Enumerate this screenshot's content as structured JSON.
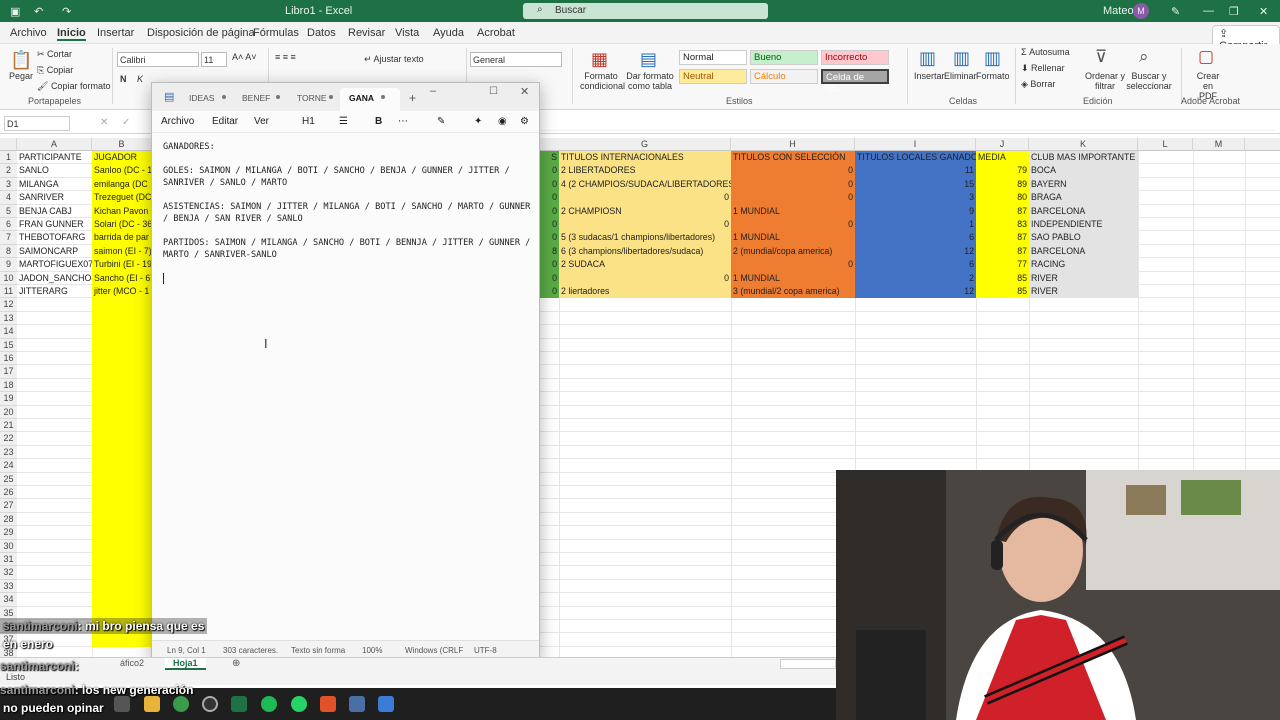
{
  "excel": {
    "window_title": "Libro1 - Excel",
    "search_placeholder": "Buscar",
    "user_name": "Mateo",
    "user_initial": "M",
    "menu": [
      "Archivo",
      "Inicio",
      "Insertar",
      "Disposición de página",
      "Fórmulas",
      "Datos",
      "Revisar",
      "Vista",
      "Ayuda",
      "Acrobat"
    ],
    "share_label": "Compartir",
    "ribbon": {
      "paste": "Pegar",
      "cut": "Cortar",
      "copy": "Copiar",
      "copy_format": "Copiar formato",
      "clipboard_group": "Portapapeles",
      "font_name": "Calibri",
      "font_size": "11",
      "wrap_text": "Ajustar texto",
      "merge_center": "Combinar y centrar",
      "number_format": "General",
      "cond_format": "Formato condicional",
      "table_format": "Dar formato como tabla",
      "styles_group": "Estilos",
      "style_normal": "Normal",
      "style_bueno": "Bueno",
      "style_incorrecto": "Incorrecto",
      "style_neutral": "Neutral",
      "style_calculo": "Cálculo",
      "style_celda": "Celda de co...",
      "insert": "Insertar",
      "delete": "Eliminar",
      "format": "Formato",
      "cells_group": "Celdas",
      "autosum": "Autosuma",
      "fill": "Rellenar",
      "clear": "Borrar",
      "sort_filter": "Ordenar y filtrar",
      "find_select": "Buscar y seleccionar",
      "edit_group": "Edición",
      "create_pdf": "Crear en PDF",
      "acrobat_group": "Adobe Acrobat"
    },
    "name_box": "D1",
    "columns": [
      "A",
      "B",
      "G",
      "H",
      "I",
      "J",
      "K",
      "L",
      "M"
    ],
    "row_numbers": [
      "1",
      "2",
      "3",
      "4",
      "5",
      "6",
      "7",
      "8",
      "9",
      "10",
      "11",
      "12",
      "13",
      "14",
      "15",
      "16",
      "17",
      "18",
      "19",
      "20",
      "21",
      "22",
      "23",
      "24",
      "25",
      "26",
      "27",
      "28",
      "29",
      "30",
      "31",
      "32",
      "33",
      "34",
      "35",
      "36",
      "37",
      "38"
    ],
    "headers": {
      "a": "PARTICIPANTE",
      "b": "JUGADOR",
      "f_tail": "S",
      "g": "TITULOS INTERNACIONALES",
      "h": "TITULOS CON SELECCIÓN",
      "i": "TITULOS LOCALES GANADOS",
      "j": "MEDIA",
      "k": "CLUB MAS IMPORTANTE"
    },
    "rows": [
      {
        "a": "SANLO",
        "b": "Sanloo (DC - 1",
        "f": "0",
        "g": "2 LIBERTADORES",
        "gnum": "",
        "h": "",
        "hnum": "0",
        "i": "11",
        "j": "79",
        "k": "BOCA"
      },
      {
        "a": "MILANGA",
        "b": "emilanga (DC",
        "f": "0",
        "g": "4 (2 CHAMPIOS/SUDACA/LIBERTADORES)",
        "gnum": "",
        "h": "",
        "hnum": "0",
        "i": "15",
        "j": "89",
        "k": "BAYERN"
      },
      {
        "a": "SANRIVER",
        "b": "Trezeguet (DC",
        "f": "0",
        "g": "",
        "gnum": "0",
        "h": "",
        "hnum": "0",
        "i": "3",
        "j": "80",
        "k": "BRAGA"
      },
      {
        "a": "BENJA CABJ",
        "b": "Kichan Pavon",
        "f": "0",
        "g": "2 CHAMPIOSN",
        "gnum": "",
        "h": "1 MUNDIAL",
        "hnum": "",
        "i": "9",
        "j": "87",
        "k": "BARCELONA"
      },
      {
        "a": "FRAN GUNNER",
        "b": "Solari (DC - 36",
        "f": "0",
        "g": "",
        "gnum": "0",
        "h": "",
        "hnum": "0",
        "i": "1",
        "j": "83",
        "k": "INDEPENDIENTE"
      },
      {
        "a": "THEBOTOFARG",
        "b": "barrida de par",
        "f": "0",
        "g": "5 (3 sudacas/1 champions/libertadores)",
        "gnum": "",
        "h": "1 MUNDIAL",
        "hnum": "",
        "i": "6",
        "j": "87",
        "k": "SAO PABLO"
      },
      {
        "a": "SAIMONCARP",
        "b": "saimon (EI - 7)",
        "f": "8",
        "g": "6 (3 champions/libertadores/sudaca)",
        "gnum": "",
        "h": "2 (mundial/copa america)",
        "hnum": "",
        "i": "12",
        "j": "87",
        "k": "BARCELONA"
      },
      {
        "a": "MARTOFIGUEX07",
        "b": "Turbini (EI - 19",
        "f": "0",
        "g": "2 SUDACA",
        "gnum": "",
        "h": "",
        "hnum": "0",
        "i": "6",
        "j": "77",
        "k": "RACING"
      },
      {
        "a": "JADON_SANCHO8",
        "b": "Sancho (EI - 67",
        "f": "0",
        "g": "",
        "gnum": "0",
        "h": "1 MUNDIAL",
        "hnum": "",
        "i": "2",
        "j": "85",
        "k": "RIVER"
      },
      {
        "a": "JITTERARG",
        "b": "jitter (MCO - 1",
        "f": "0",
        "g": "2 liertadores",
        "gnum": "",
        "h": "3 (mundial/2 copa america)",
        "hnum": "",
        "i": "12",
        "j": "85",
        "k": "RIVER"
      }
    ],
    "sheet_tab_partial": "áfico2",
    "sheet_tab_active": "Hoja1",
    "status_ready": "Listo"
  },
  "notepad": {
    "tabs": [
      "IDEAS",
      "BENEF",
      "TORNE",
      "GANA"
    ],
    "active_tab": "GANA",
    "new_tab": "+",
    "menu": [
      "Archivo",
      "Editar",
      "Ver"
    ],
    "heading_btn": "H1",
    "bold_btn": "B",
    "content": "GANADORES:\n\nGOLES: SAIMON / MILANGA / BOTI / SANCHO / BENJA / GUNNER / JITTER / SANRIVER / SANLO / MARTO\n\nASISTENCIAS: SAIMON / JITTER / MILANGA / BOTI / SANCHO / MARTO / GUNNER / BENJA / SAN RIVER / SANLO\n\nPARTIDOS: SAIMON / MILANGA / SANCHO / BOTI / BENNJA / JITTER / GUNNER / MARTO / SANRIVER-SANLO\n\n",
    "status": {
      "position": "Ln 9, Col 1",
      "chars": "303 caracteres.",
      "format": "Texto sin forma",
      "zoom": "100%",
      "eol": "Windows (CRLF",
      "encoding": "UTF-8"
    }
  },
  "chat": [
    {
      "user": "santimarconi",
      "text": ": mi bro piensa que es"
    },
    {
      "user": "",
      "text": "en enero"
    },
    {
      "user": "santimarconi",
      "text": ":"
    },
    {
      "user": "santimarconi",
      "text": ": los new generación"
    },
    {
      "user": "",
      "text": "no pueden opinar"
    }
  ],
  "colors": {
    "excel_green": "#1e7145",
    "header_yellow": "#ffff00",
    "titles_intl": "#fbe287",
    "titles_national": "#ee7d31",
    "titles_local": "#4472c4",
    "club_gray": "#e3e3e3",
    "f_green": "#5aaa46"
  }
}
